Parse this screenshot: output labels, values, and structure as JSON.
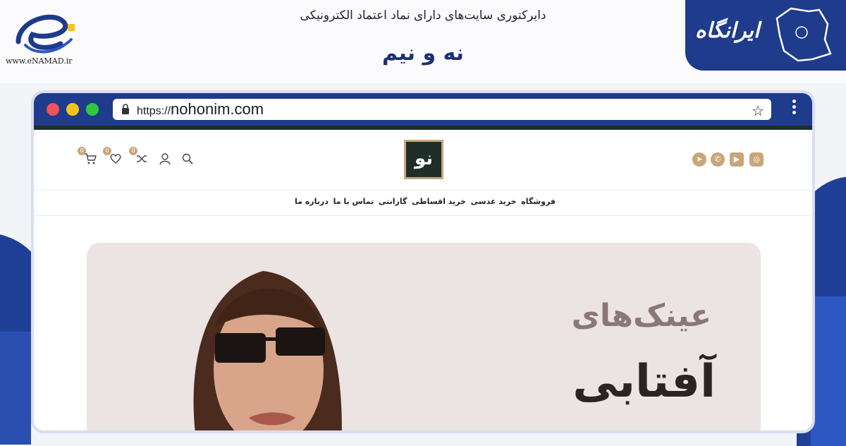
{
  "banner": {
    "enamad_url": "www.eNAMAD.ir",
    "directory_title": "دایرکتوری سایت‌های دارای نماد اعتماد الکترونیکی",
    "site_name": "نه و نیم",
    "irangah_logo_text": "ایرانگاه"
  },
  "browser": {
    "url_protocol": "https://",
    "url_host": "nohonim.com"
  },
  "site": {
    "logo_text": "نو",
    "header_icons": [
      "cart-icon",
      "heart-icon",
      "shuffle-icon",
      "user-icon",
      "search-icon"
    ],
    "cart_count": "0",
    "wishlist_count": "0",
    "compare_count": "0",
    "social_icons": [
      "telegram-icon",
      "whatsapp-icon",
      "youtube-icon",
      "instagram-icon"
    ],
    "nav": [
      "فروشگاه",
      "خرید عدسی",
      "خرید اقساطی",
      "گارانتی",
      "تماس با ما",
      "درباره ما"
    ],
    "hero": {
      "line1": "عینک‌های",
      "line2": "آفتابی"
    }
  },
  "colors": {
    "brand_blue": "#1e3b8c",
    "accent_gold": "#c9a57b",
    "dark_green": "#1f2e28"
  }
}
